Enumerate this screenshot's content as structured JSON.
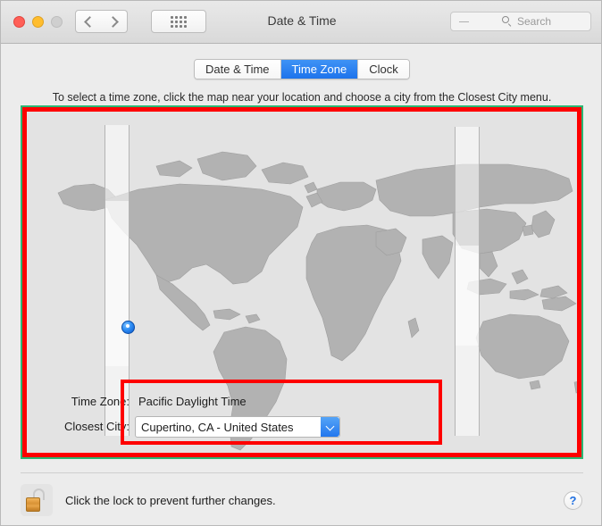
{
  "window": {
    "title": "Date & Time",
    "traffic_lights": [
      "close",
      "minimize",
      "zoom"
    ]
  },
  "toolbar": {
    "back_label": "Back",
    "forward_label": "Forward",
    "show_all_label": "Show All",
    "search": {
      "placeholder": "Search",
      "value": ""
    }
  },
  "tabs": [
    {
      "label": "Date & Time",
      "selected": false
    },
    {
      "label": "Time Zone",
      "selected": true
    },
    {
      "label": "Clock",
      "selected": false
    }
  ],
  "instruction": "To select a time zone, click the map near your location and choose a city from the Closest City menu.",
  "map": {
    "selected_marker_label": "Current location",
    "highlighted_band_label": "Selected time zone band"
  },
  "form": {
    "time_zone_label": "Time Zone:",
    "time_zone_value": "Pacific Daylight Time",
    "closest_city_label": "Closest City:",
    "closest_city_value": "Cupertino, CA - United States"
  },
  "footer": {
    "lock_text": "Click the lock to prevent further changes.",
    "lock_state": "unlocked",
    "help_label": "?"
  },
  "annotations": {
    "map_highlight_color": "#fe0000",
    "form_highlight_color": "#fe0000",
    "map_border_color": "#2bb673"
  },
  "colors": {
    "accent_blue": "#2277ee",
    "tab_selected_blue": "#1d73ec",
    "land": "#b0b0b0",
    "ocean": "#e3e3e3"
  }
}
